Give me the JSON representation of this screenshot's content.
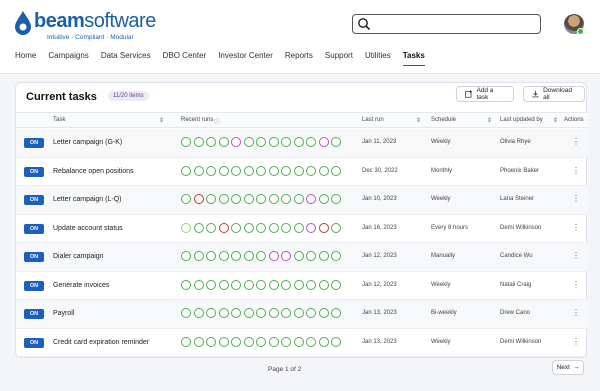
{
  "brand": {
    "name_bold": "beam",
    "name_soft": "software",
    "tagline": "Intuitive · Compliant · Modular",
    "color": "#1b5fa8"
  },
  "nav": [
    {
      "label": "Home"
    },
    {
      "label": "Campaigns"
    },
    {
      "label": "Data Services"
    },
    {
      "label": "DBO Center"
    },
    {
      "label": "Investor Center"
    },
    {
      "label": "Reports"
    },
    {
      "label": "Support"
    },
    {
      "label": "Utilities"
    },
    {
      "label": "Tasks",
      "active": true
    }
  ],
  "search": {
    "placeholder": ""
  },
  "main": {
    "title": "Current tasks",
    "count_badge": "11/20 items",
    "add_label": "Add a task",
    "download_label": "Download all",
    "columns": {
      "task": "Task",
      "runs": "Recent runs",
      "last_run": "Last run",
      "schedule": "Schedule",
      "updated_by": "Last updated by",
      "actions": "Actions"
    }
  },
  "status_colors": {
    "success": "#4caf50",
    "fail": "#c0392b",
    "warn": "#c04fc0",
    "pending": "#9ad46c"
  },
  "rows": [
    {
      "toggle": "ON",
      "task": "Letter campaign (G-K)",
      "last_run": "Jan 11, 2023",
      "schedule": "Weekly",
      "updated_by": "Olivia Rhye",
      "runs": [
        "s",
        "s",
        "s",
        "s",
        "w",
        "s",
        "s",
        "s",
        "s",
        "s",
        "s",
        "w",
        "s"
      ]
    },
    {
      "toggle": "ON",
      "task": "Rebalance open positions",
      "last_run": "Dec 30, 2022",
      "schedule": "Monthly",
      "updated_by": "Phoenix Baker",
      "runs": [
        "s",
        "s",
        "s",
        "s",
        "s",
        "s",
        "s",
        "s",
        "s",
        "s",
        "s",
        "s",
        "s"
      ]
    },
    {
      "toggle": "ON",
      "task": "Letter campaign (L-Q)",
      "last_run": "Jan 10, 2023",
      "schedule": "Weekly",
      "updated_by": "Lana Steiner",
      "runs": [
        "s",
        "f",
        "s",
        "s",
        "s",
        "s",
        "s",
        "s",
        "s",
        "s",
        "w",
        "s",
        "s"
      ]
    },
    {
      "toggle": "ON",
      "task": "Update account status",
      "last_run": "Jan 16, 2023",
      "schedule": "Every 8 hours",
      "updated_by": "Demi Wilkinson",
      "runs": [
        "p",
        "s",
        "s",
        "f",
        "s",
        "s",
        "s",
        "s",
        "s",
        "s",
        "w",
        "f",
        "s"
      ]
    },
    {
      "toggle": "ON",
      "task": "Dialer campaign",
      "last_run": "Jan 12, 2023",
      "schedule": "Manually",
      "updated_by": "Candice Wu",
      "runs": [
        "s",
        "s",
        "s",
        "s",
        "s",
        "s",
        "s",
        "w",
        "w",
        "s",
        "s",
        "s",
        "s"
      ]
    },
    {
      "toggle": "ON",
      "task": "Generate invoices",
      "last_run": "Jan 12, 2023",
      "schedule": "Weekly",
      "updated_by": "Natali Craig",
      "runs": [
        "s",
        "s",
        "s",
        "s",
        "s",
        "s",
        "s",
        "s",
        "s",
        "s",
        "s",
        "s",
        "s"
      ]
    },
    {
      "toggle": "ON",
      "task": "Payroll",
      "last_run": "Jan 13, 2023",
      "schedule": "Bi-weekly",
      "updated_by": "Drew Cano",
      "runs": [
        "s",
        "s",
        "s",
        "s",
        "s",
        "s",
        "s",
        "s",
        "s",
        "s",
        "s",
        "s",
        "s"
      ]
    },
    {
      "toggle": "ON",
      "task": "Credit card expiration reminder",
      "last_run": "Jan 13, 2023",
      "schedule": "Weekly",
      "updated_by": "Demi Wilkinson",
      "runs": [
        "s",
        "s",
        "s",
        "s",
        "s",
        "s",
        "s",
        "s",
        "s",
        "s",
        "s",
        "s",
        "s"
      ]
    }
  ],
  "pagination": {
    "label": "Page 1 of 2",
    "next_label": "Next"
  }
}
